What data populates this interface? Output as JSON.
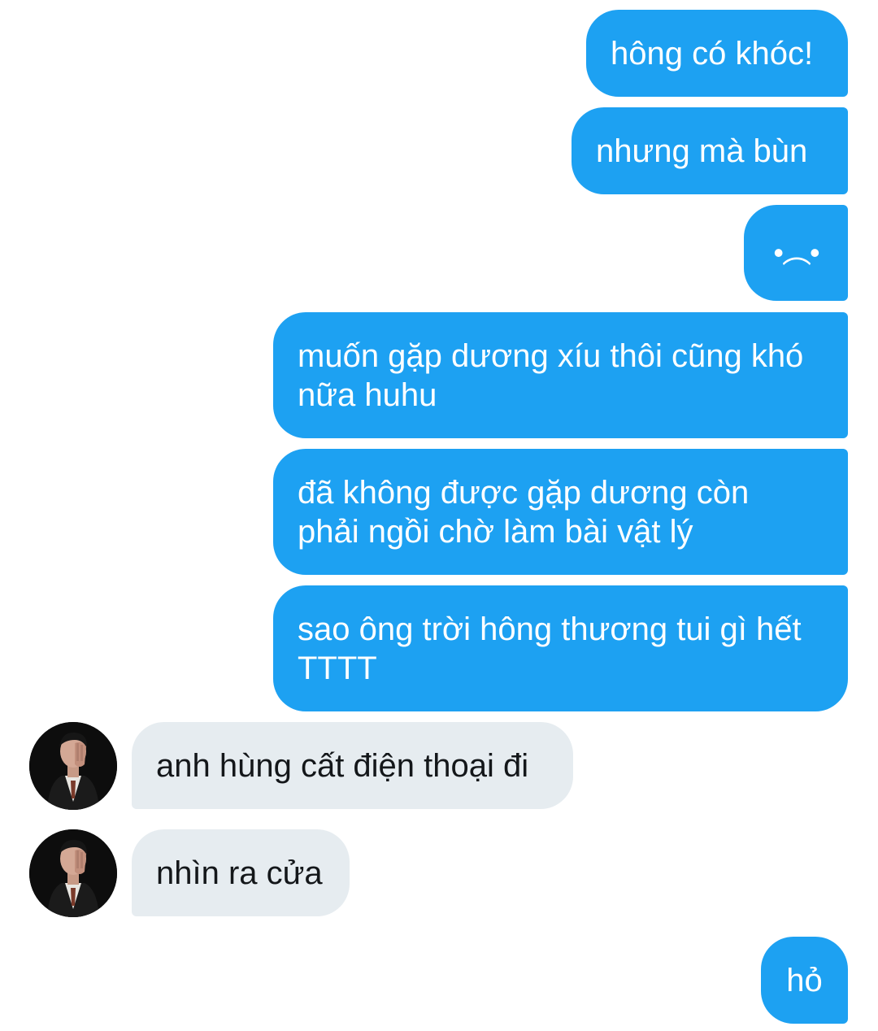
{
  "colors": {
    "sent_bubble": "#1da1f2",
    "sent_text": "#ffffff",
    "received_bubble": "#e6ecf0",
    "received_text": "#14171a"
  },
  "messages": [
    {
      "direction": "sent",
      "lines": [
        "hông có khóc!"
      ]
    },
    {
      "direction": "sent",
      "lines": [
        "nhưng mà bùn"
      ]
    },
    {
      "direction": "sent",
      "lines": [
        "•︵•"
      ]
    },
    {
      "direction": "sent",
      "lines": [
        "muốn gặp dương xíu thôi cũng khó",
        "nữa huhu"
      ]
    },
    {
      "direction": "sent",
      "lines": [
        "đã không được gặp dương còn",
        "phải ngồi chờ làm bài vật lý"
      ]
    },
    {
      "direction": "sent",
      "lines": [
        "sao ông trời hông thương tui gì hết",
        "TTTT"
      ]
    },
    {
      "direction": "received",
      "lines": [
        "anh hùng cất điện thoại đi"
      ],
      "avatar": "contact-avatar"
    },
    {
      "direction": "received",
      "lines": [
        "nhìn ra cửa"
      ],
      "avatar": "contact-avatar"
    },
    {
      "direction": "sent",
      "lines": [
        "hỏ"
      ]
    }
  ]
}
